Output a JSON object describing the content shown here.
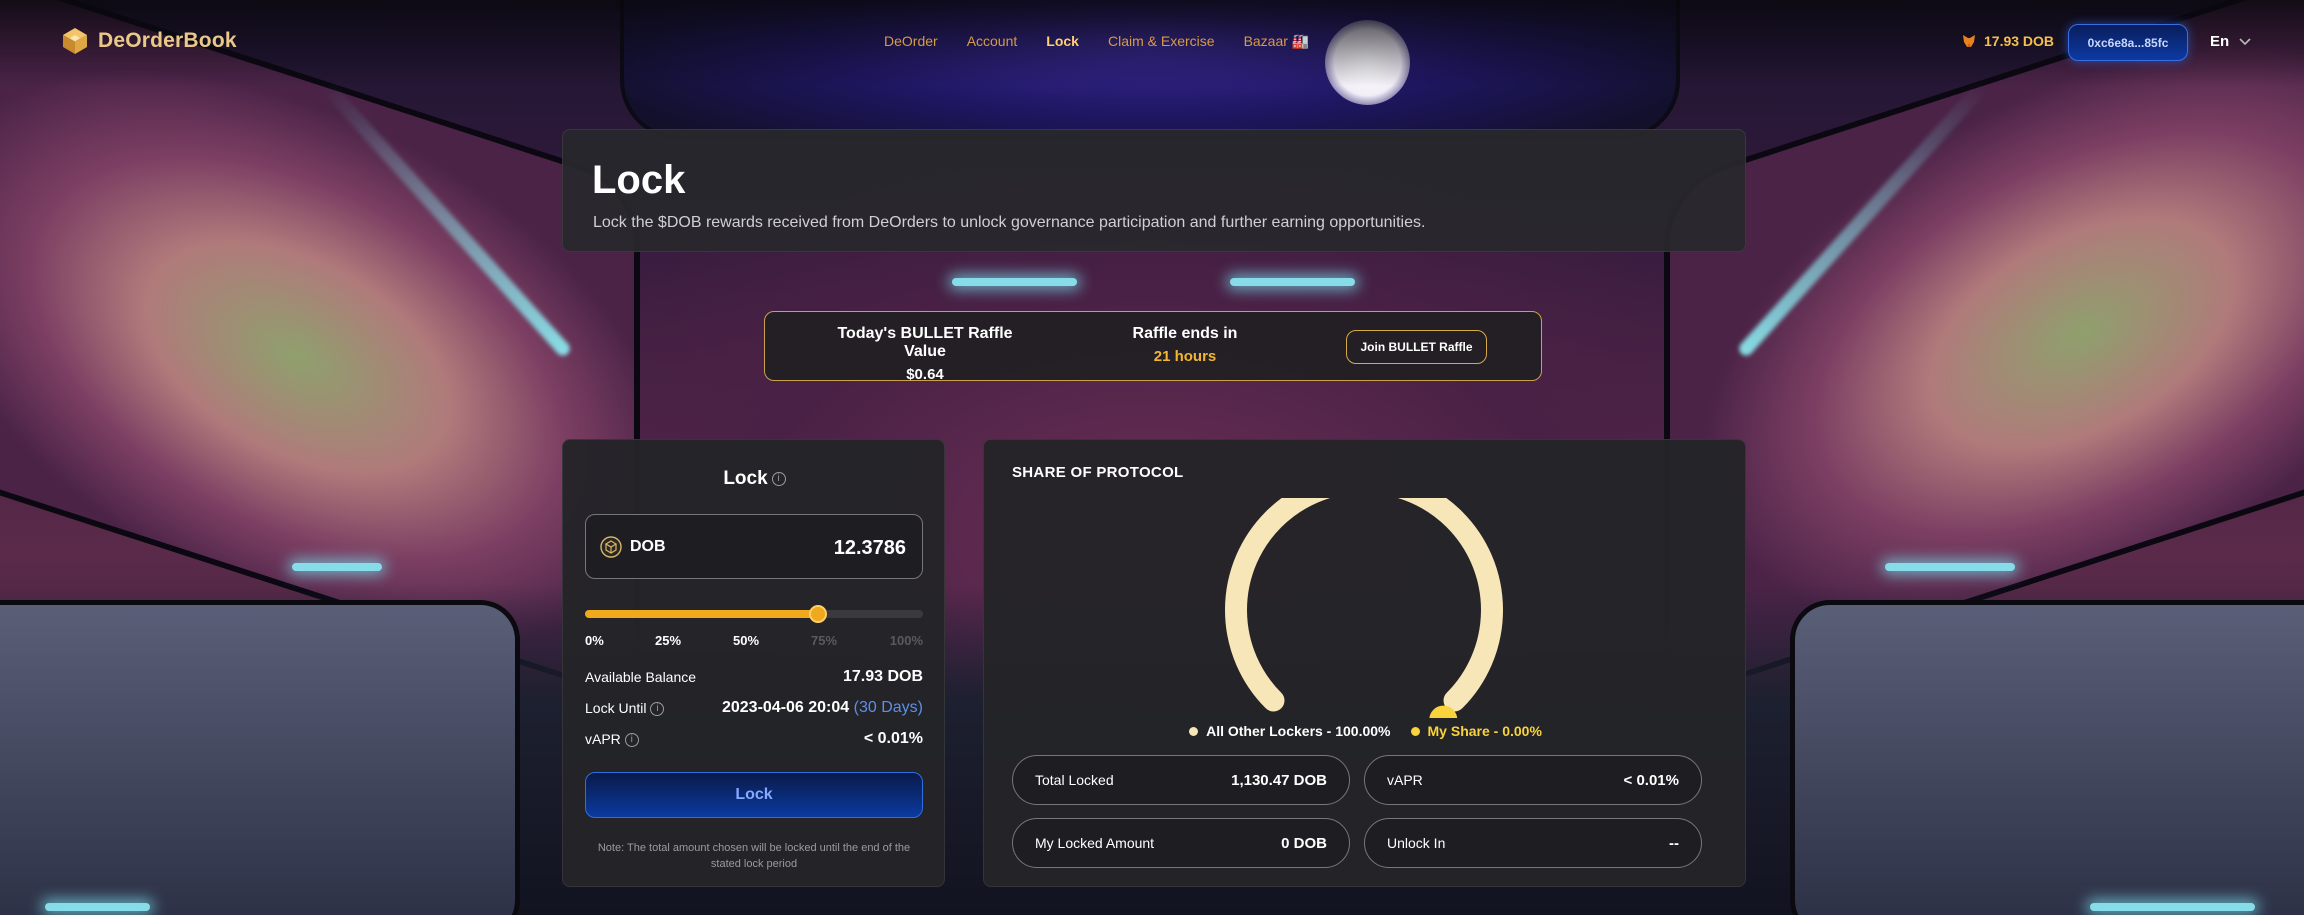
{
  "header": {
    "logo_text": "DeOrderBook",
    "nav": [
      "DeOrder",
      "Account",
      "Lock",
      "Claim & Exercise",
      "Bazaar 🏭"
    ],
    "active_nav": "Lock",
    "balance": "17.93 DOB",
    "wallet": "0xc6e8a...85fc",
    "language": "En"
  },
  "page": {
    "title": "Lock",
    "subtitle": "Lock the $DOB rewards received from DeOrders to unlock governance participation and further earning opportunities."
  },
  "raffle": {
    "value_label": "Today's BULLET Raffle Value",
    "value": "$0.64",
    "ends_label": "Raffle ends in",
    "ends_value": "21 hours",
    "button": "Join BULLET Raffle"
  },
  "lock": {
    "title": "Lock",
    "token": "DOB",
    "amount": "12.3786",
    "slider_fraction": 0.69,
    "ticks": [
      "0%",
      "25%",
      "50%",
      "75%",
      "100%"
    ],
    "available_label": "Available Balance",
    "available_value": "17.93 DOB",
    "lock_until_label": "Lock Until",
    "lock_until_date": "2023-04-06 20:04",
    "lock_until_days": "(30 Days)",
    "vapr_label": "vAPR",
    "vapr_value": "< 0.01%",
    "button": "Lock",
    "note": "Note: The total amount chosen will be locked until the end of the stated lock period"
  },
  "share": {
    "title": "SHARE OF PROTOCOL",
    "legend": [
      {
        "label": "All Other Lockers - 100.00%",
        "color": "#f7e6b8"
      },
      {
        "label": "My Share - 0.00%",
        "color": "#f9d33c"
      }
    ],
    "other_share_fraction": 1.0,
    "total_locked_label": "Total Locked",
    "total_locked_value": "1,130.47 DOB",
    "vapr_label": "vAPR",
    "vapr_value": "< 0.01%",
    "my_locked_label": "My Locked Amount",
    "my_locked_value": "0 DOB",
    "unlock_label": "Unlock In",
    "unlock_value": "--"
  },
  "colors": {
    "accent": "#f0a81d",
    "gold": "#f2b630",
    "button_blue": "#0b3aa0",
    "gauge_other": "#f7e6b8",
    "gauge_mine": "#f9d33c"
  }
}
